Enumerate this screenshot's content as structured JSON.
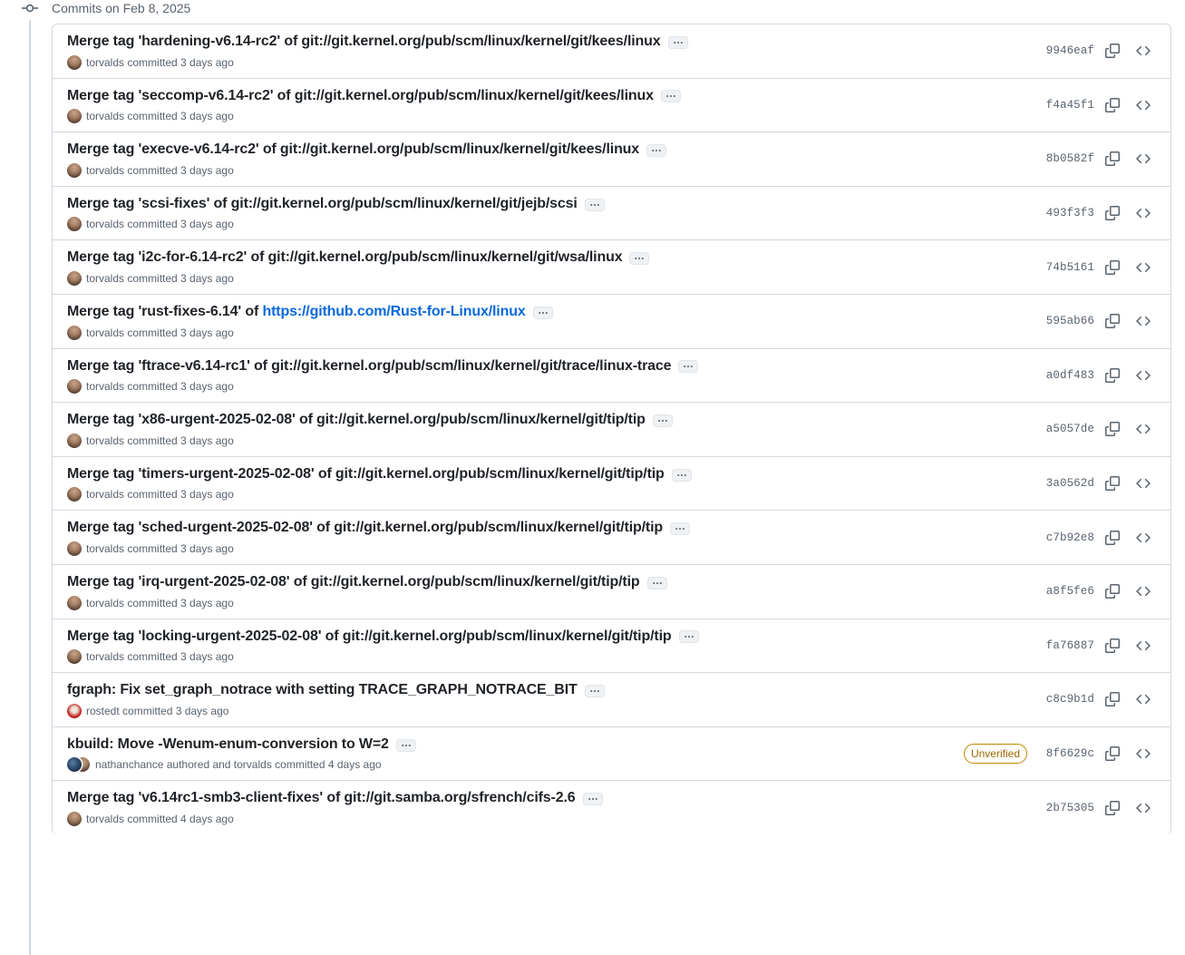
{
  "timeline": {
    "header_label": "Commits on Feb 8, 2025",
    "commit_dot_icon": "git-commit-icon"
  },
  "icons": {
    "expand": "ellipsis-icon",
    "copy": "copy-icon",
    "code": "code-icon"
  },
  "colors": {
    "link": "#0969da",
    "muted": "#59636e",
    "border": "#d1d9e0",
    "unverified_border": "#bf8700",
    "unverified_text": "#9a6700",
    "text": "#1f2328"
  },
  "commits": [
    {
      "title_prefix": "Merge tag 'hardening-v6.14-rc2' of git://git.kernel.org/pub/scm/linux/kernel/git/kees/linux",
      "title_link": "",
      "author": "torvalds",
      "meta_text": "committed 3 days ago",
      "avatar": "torvalds",
      "sha": "9946eaf",
      "badge": ""
    },
    {
      "title_prefix": "Merge tag 'seccomp-v6.14-rc2' of git://git.kernel.org/pub/scm/linux/kernel/git/kees/linux",
      "title_link": "",
      "author": "torvalds",
      "meta_text": "committed 3 days ago",
      "avatar": "torvalds",
      "sha": "f4a45f1",
      "badge": ""
    },
    {
      "title_prefix": "Merge tag 'execve-v6.14-rc2' of git://git.kernel.org/pub/scm/linux/kernel/git/kees/linux",
      "title_link": "",
      "author": "torvalds",
      "meta_text": "committed 3 days ago",
      "avatar": "torvalds",
      "sha": "8b0582f",
      "badge": ""
    },
    {
      "title_prefix": "Merge tag 'scsi-fixes' of git://git.kernel.org/pub/scm/linux/kernel/git/jejb/scsi",
      "title_link": "",
      "author": "torvalds",
      "meta_text": "committed 3 days ago",
      "avatar": "torvalds",
      "sha": "493f3f3",
      "badge": ""
    },
    {
      "title_prefix": "Merge tag 'i2c-for-6.14-rc2' of git://git.kernel.org/pub/scm/linux/kernel/git/wsa/linux",
      "title_link": "",
      "author": "torvalds",
      "meta_text": "committed 3 days ago",
      "avatar": "torvalds",
      "sha": "74b5161",
      "badge": ""
    },
    {
      "title_prefix": "Merge tag 'rust-fixes-6.14' of ",
      "title_link": "https://github.com/Rust-for-Linux/linux",
      "author": "torvalds",
      "meta_text": "committed 3 days ago",
      "avatar": "torvalds",
      "sha": "595ab66",
      "badge": ""
    },
    {
      "title_prefix": "Merge tag 'ftrace-v6.14-rc1' of git://git.kernel.org/pub/scm/linux/kernel/git/trace/linux-trace",
      "title_link": "",
      "author": "torvalds",
      "meta_text": "committed 3 days ago",
      "avatar": "torvalds",
      "sha": "a0df483",
      "badge": ""
    },
    {
      "title_prefix": "Merge tag 'x86-urgent-2025-02-08' of git://git.kernel.org/pub/scm/linux/kernel/git/tip/tip",
      "title_link": "",
      "author": "torvalds",
      "meta_text": "committed 3 days ago",
      "avatar": "torvalds",
      "sha": "a5057de",
      "badge": ""
    },
    {
      "title_prefix": "Merge tag 'timers-urgent-2025-02-08' of git://git.kernel.org/pub/scm/linux/kernel/git/tip/tip",
      "title_link": "",
      "author": "torvalds",
      "meta_text": "committed 3 days ago",
      "avatar": "torvalds",
      "sha": "3a0562d",
      "badge": ""
    },
    {
      "title_prefix": "Merge tag 'sched-urgent-2025-02-08' of git://git.kernel.org/pub/scm/linux/kernel/git/tip/tip",
      "title_link": "",
      "author": "torvalds",
      "meta_text": "committed 3 days ago",
      "avatar": "torvalds",
      "sha": "c7b92e8",
      "badge": ""
    },
    {
      "title_prefix": "Merge tag 'irq-urgent-2025-02-08' of git://git.kernel.org/pub/scm/linux/kernel/git/tip/tip",
      "title_link": "",
      "author": "torvalds",
      "meta_text": "committed 3 days ago",
      "avatar": "torvalds",
      "sha": "a8f5fe6",
      "badge": ""
    },
    {
      "title_prefix": "Merge tag 'locking-urgent-2025-02-08' of git://git.kernel.org/pub/scm/linux/kernel/git/tip/tip",
      "title_link": "",
      "author": "torvalds",
      "meta_text": "committed 3 days ago",
      "avatar": "torvalds",
      "sha": "fa76887",
      "badge": ""
    },
    {
      "title_prefix": "fgraph: Fix set_graph_notrace with setting TRACE_GRAPH_NOTRACE_BIT",
      "title_link": "",
      "author": "rostedt",
      "meta_text": "committed 3 days ago",
      "avatar": "rostedt",
      "sha": "c8c9b1d",
      "badge": ""
    },
    {
      "title_prefix": "kbuild: Move -Wenum-enum-conversion to W=2",
      "title_link": "",
      "author": "nathanchance",
      "meta_text": "authored and torvalds committed 4 days ago",
      "avatar": "stack",
      "sha": "8f6629c",
      "badge": "Unverified"
    },
    {
      "title_prefix": "Merge tag 'v6.14rc1-smb3-client-fixes' of git://git.samba.org/sfrench/cifs-2.6",
      "title_link": "",
      "author": "torvalds",
      "meta_text": "committed 4 days ago",
      "avatar": "torvalds",
      "sha": "2b75305",
      "badge": ""
    }
  ]
}
